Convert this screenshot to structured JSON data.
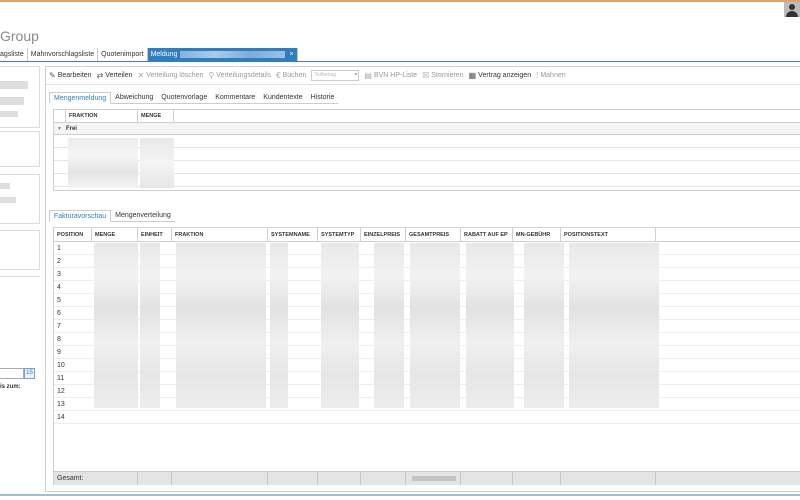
{
  "brand": "Group",
  "doc_tabs": [
    {
      "label": "agsliste"
    },
    {
      "label": "Mahnvorschlagsliste"
    },
    {
      "label": "Quotenimport"
    },
    {
      "label": "Meldung",
      "active": true,
      "close": "×"
    }
  ],
  "toolbar": {
    "items": [
      {
        "label": "Bearbeiten",
        "icon": "pencil-icon",
        "glyph": "✎",
        "enabled": true
      },
      {
        "label": "Verteilen",
        "icon": "split-icon",
        "glyph": "⇄",
        "enabled": true
      },
      {
        "label": "Verteilung löschen",
        "icon": "delete-icon",
        "glyph": "✕",
        "enabled": false
      },
      {
        "label": "Verteilungsdetails",
        "icon": "search-icon",
        "glyph": "⚲",
        "enabled": false
      },
      {
        "label": "Buchen",
        "icon": "euro-icon",
        "glyph": "€",
        "enabled": false
      }
    ],
    "select_placeholder": "Teilbetrag",
    "items2": [
      {
        "label": "BVN HP-Liste",
        "icon": "list-icon",
        "glyph": "▤",
        "enabled": false
      },
      {
        "label": "Stornieren",
        "icon": "cancel-icon",
        "glyph": "☒",
        "enabled": false
      },
      {
        "label": "Vertrag anzeigen",
        "icon": "document-icon",
        "glyph": "▦",
        "enabled": true
      },
      {
        "label": "Mahnen",
        "icon": "exclamation-icon",
        "glyph": "!",
        "enabled": false
      }
    ]
  },
  "top_tabs": [
    {
      "label": "Mengenmeldung",
      "active": true
    },
    {
      "label": "Abweichung"
    },
    {
      "label": "Quotenvorlage"
    },
    {
      "label": "Kommentare"
    },
    {
      "label": "Kundentexte"
    },
    {
      "label": "Historie"
    }
  ],
  "grid1": {
    "columns": [
      "FRAKTION",
      "MENGE"
    ],
    "group_label": "Frei",
    "group_toggle": "▼"
  },
  "bottom_tabs": [
    {
      "label": "Fakturavorschau",
      "active": true
    },
    {
      "label": "Mengenverteilung"
    }
  ],
  "grid2": {
    "columns": [
      "POSITION",
      "MENGE",
      "EINHEIT",
      "FRAKTION",
      "SYSTEMNAME",
      "SYSTEMTYP",
      "EINZELPREIS",
      "GESAMTPREIS",
      "RABATT AUF EP",
      "MN-GEBÜHR",
      "POSITIONSTEXT"
    ],
    "positions": [
      "1",
      "2",
      "3",
      "4",
      "5",
      "6",
      "7",
      "8",
      "9",
      "10",
      "11",
      "12",
      "13",
      "14"
    ],
    "footer_label": "Gesamt:"
  },
  "left_panel": {
    "cal_glyph": "15",
    "label_zum": "is zum:"
  }
}
